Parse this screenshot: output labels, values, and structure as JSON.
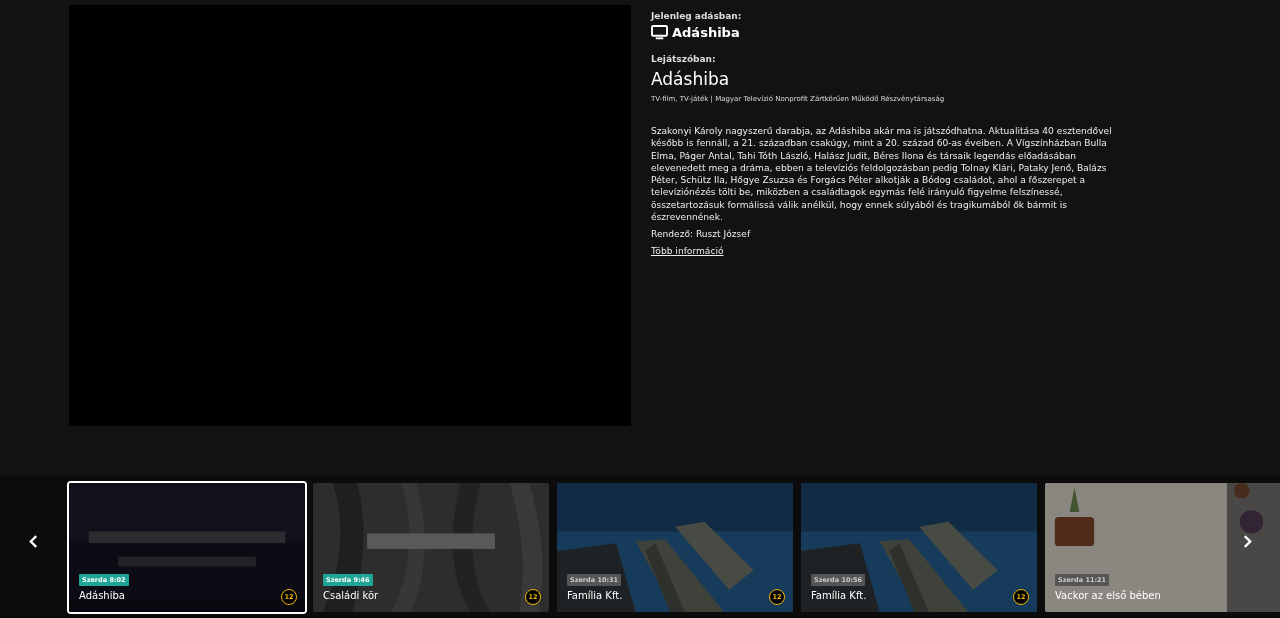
{
  "now_on_air": {
    "label": "Jelenleg adásban:",
    "title": "Adáshiba"
  },
  "playing": {
    "label": "Lejátszóban:",
    "title": "Adáshiba",
    "meta": "TV-film, TV-játék | Magyar Televízió Nonprofit Zártkörűen Működő Részvénytársaság",
    "description": "Szakonyi Károly nagyszerű darabja, az Adáshiba akár ma is játszódhatna. Aktualitása 40 esztendővel később is fennáll, a 21. században csakúgy, mint a 20. század 60-as éveiben. A Vígszínházban Bulla Elma, Páger Antal, Tahi Tóth László, Halász Judit, Béres Ilona és társaik legendás előadásában elevenedett meg a dráma, ebben a televíziós feldolgozásban pedig Tolnay Klári, Pataky Jenő, Balázs Péter, Schütz Ila, Hőgye Zsuzsa és Forgács Péter alkotják a Bódog családot, ahol a főszerepet a televíziónézés tölti be, miközben a családtagok egymás felé irányuló figyelme felszínessé, összetartozásuk formálissá válik anélkül, hogy ennek súlyából és tragikumából ők bármit is észrevennének.",
    "director": "Rendező: Ruszt József",
    "more_link": "Több információ"
  },
  "schedule": [
    {
      "time": "Szerda 8:02",
      "title": "Adáshiba",
      "rating": "12",
      "selected": true,
      "aired": true
    },
    {
      "time": "Szerda 9:46",
      "title": "Családi kör",
      "rating": "12",
      "selected": false,
      "aired": true
    },
    {
      "time": "Szerda 10:31",
      "title": "Família Kft.",
      "rating": "12",
      "selected": false,
      "aired": false
    },
    {
      "time": "Szerda 10:56",
      "title": "Família Kft.",
      "rating": "12",
      "selected": false,
      "aired": false
    },
    {
      "time": "Szerda 11:21",
      "title": "Vackor az első bében",
      "selected": false,
      "aired": false
    }
  ]
}
